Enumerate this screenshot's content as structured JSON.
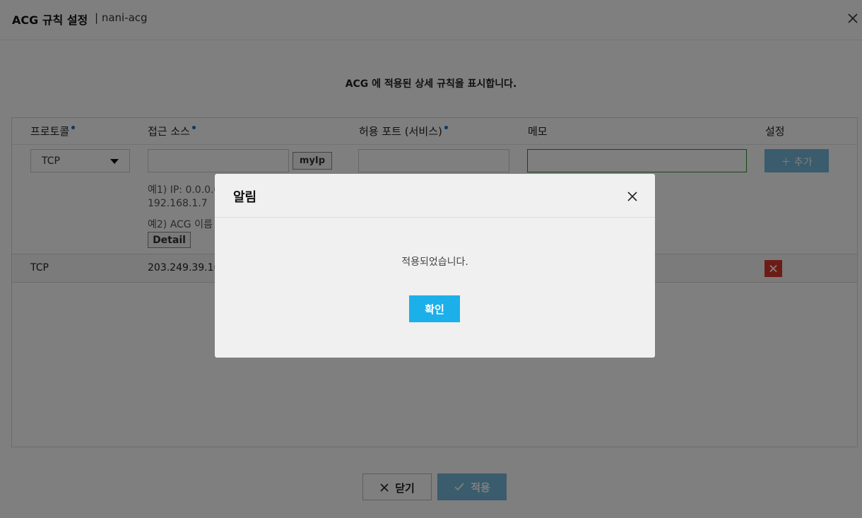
{
  "header": {
    "title": "ACG 규칙 설정",
    "subtitle": "| nani-acg",
    "close_icon": "close-icon"
  },
  "description": "ACG 에 적용된 상세 규칙을 표시합니다.",
  "table": {
    "columns": [
      "프로토콜",
      "접근 소스",
      "허용 포트 (서비스)",
      "메모",
      "설정"
    ],
    "input_row": {
      "protocol_selected": "TCP",
      "source_value": "",
      "myip_label": "myIp",
      "port_value": "",
      "memo_value": "",
      "add_label": "추가",
      "hint_1": "예1) IP: 0.0.0.0",
      "hint_1b": "192.168.1.7",
      "hint_2": "예2) ACG 이름",
      "detail_label": "Detail"
    },
    "rows": [
      {
        "protocol": "TCP",
        "source": "203.249.39.16"
      }
    ]
  },
  "footer": {
    "close_label": "닫기",
    "apply_label": "적용"
  },
  "modal": {
    "title": "알림",
    "message": "적용되었습니다.",
    "ok_label": "확인"
  },
  "colors": {
    "accent": "#1cb0ea",
    "disabled_button": "#74b9d8",
    "delete_button": "#d8382d",
    "required_dot": "#1a6fc9",
    "memo_focus": "#2e8b3a"
  }
}
